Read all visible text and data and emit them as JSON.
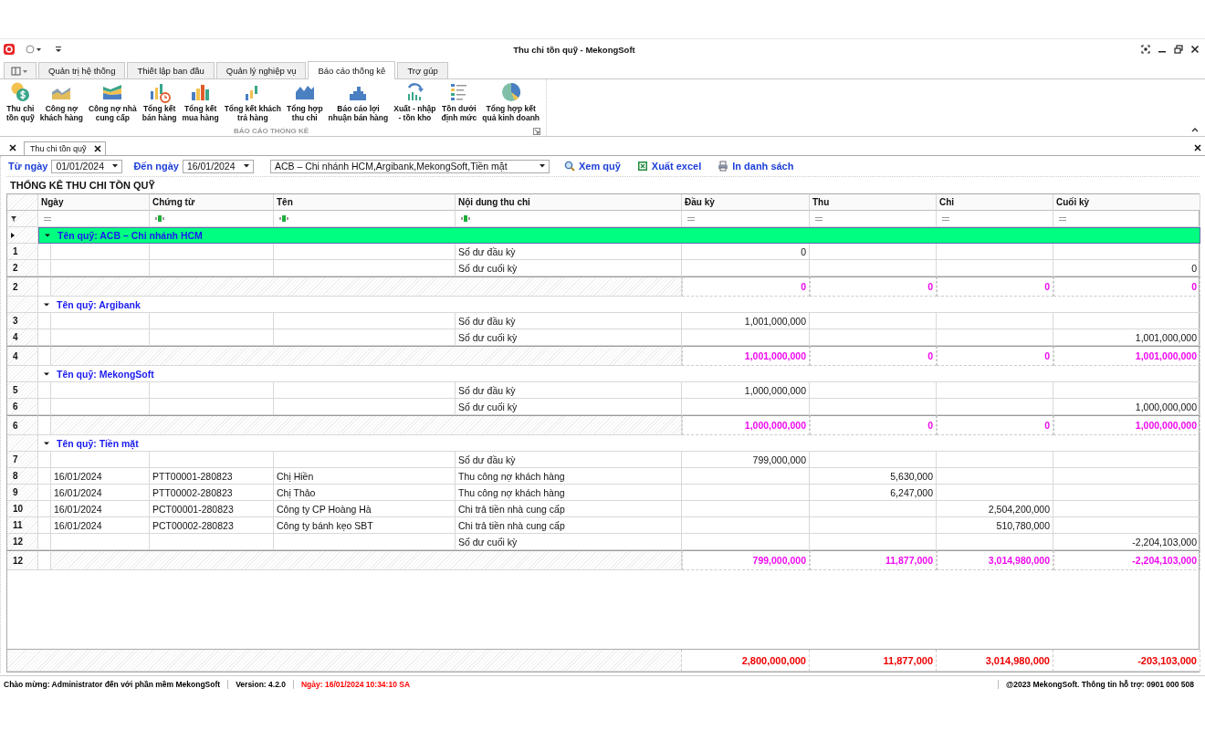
{
  "window": {
    "title": "Thu chi tồn quỹ - MekongSoft"
  },
  "tabs": [
    {
      "label": "Quản trị hệ thống",
      "selected": false
    },
    {
      "label": "Thiết lập ban đầu",
      "selected": false
    },
    {
      "label": "Quản lý nghiệp vụ",
      "selected": false
    },
    {
      "label": "Báo cáo thống kê",
      "selected": true
    },
    {
      "label": "Trợ gúp",
      "selected": false
    }
  ],
  "ribbon": {
    "group_label": "BÁO CÁO THỐNG KÊ",
    "buttons": [
      {
        "label": "Thu chi\ntồn quỹ"
      },
      {
        "label": "Công nợ\nkhách hàng"
      },
      {
        "label": "Công nợ nhà\ncung cấp"
      },
      {
        "label": "Tổng kết\nbán hàng"
      },
      {
        "label": "Tổng kết\nmua hàng"
      },
      {
        "label": "Tổng kết khách\ntrả hàng"
      },
      {
        "label": "Tổng hợp\nthu chi"
      },
      {
        "label": "Báo cáo lợi\nnhuận bán hàng"
      },
      {
        "label": "Xuất - nhập\n- tồn kho"
      },
      {
        "label": "Tồn dưới\nđịnh mức"
      },
      {
        "label": "Tổng hợp kết\nquả kinh doanh"
      }
    ]
  },
  "document_tabs": [
    {
      "label": "Thu chi tồn quỹ",
      "selected": true
    }
  ],
  "toolbar": {
    "from_label": "Từ ngày",
    "from_value": "01/01/2024",
    "to_label": "Đến ngày",
    "to_value": "16/01/2024",
    "fund_value": "ACB – Chi nhánh HCM,Argibank,MekongSoft,Tiền mặt",
    "buttons": [
      {
        "label": "Xem quỹ"
      },
      {
        "label": "Xuất excel"
      },
      {
        "label": "In danh sách"
      }
    ]
  },
  "report_title": "THỐNG KÊ THU CHI TỒN QUỸ",
  "grid": {
    "columns": [
      "Ngày",
      "Chứng từ",
      "Tên",
      "Nội dung thu chi",
      "Đầu kỳ",
      "Thu",
      "Chi",
      "Cuối kỳ"
    ],
    "groups": [
      {
        "title": "Tên quỹ: ACB – Chi nhánh HCM",
        "selected": true,
        "expanded": true,
        "rows": [
          {
            "number": "1",
            "content": "Số dư đầu kỳ",
            "opening": "0"
          },
          {
            "number": "2",
            "content": "Số dư cuối kỳ",
            "closing": "0"
          }
        ],
        "summary": {
          "number": "2",
          "opening": "0",
          "receipts": "0",
          "payments": "0",
          "closing": "0"
        }
      },
      {
        "title": "Tên quỹ: Argibank",
        "selected": false,
        "expanded": true,
        "rows": [
          {
            "number": "3",
            "content": "Số dư đầu kỳ",
            "opening": "1,001,000,000"
          },
          {
            "number": "4",
            "content": "Số dư cuối kỳ",
            "closing": "1,001,000,000"
          }
        ],
        "summary": {
          "number": "4",
          "opening": "1,001,000,000",
          "receipts": "0",
          "payments": "0",
          "closing": "1,001,000,000"
        }
      },
      {
        "title": "Tên quỹ: MekongSoft",
        "selected": false,
        "expanded": true,
        "rows": [
          {
            "number": "5",
            "content": "Số dư đầu kỳ",
            "opening": "1,000,000,000"
          },
          {
            "number": "6",
            "content": "Số dư cuối kỳ",
            "closing": "1,000,000,000"
          }
        ],
        "summary": {
          "number": "6",
          "opening": "1,000,000,000",
          "receipts": "0",
          "payments": "0",
          "closing": "1,000,000,000"
        }
      },
      {
        "title": "Tên quỹ: Tiền mặt",
        "selected": false,
        "expanded": true,
        "rows": [
          {
            "number": "7",
            "content": "Số dư đầu kỳ",
            "opening": "799,000,000"
          },
          {
            "number": "8",
            "date": "16/01/2024",
            "voucher": "PTT00001-280823",
            "name": "Chị Hiền",
            "content": "Thu công nợ khách hàng",
            "receipts": "5,630,000"
          },
          {
            "number": "9",
            "date": "16/01/2024",
            "voucher": "PTT00002-280823",
            "name": "Chị Thảo",
            "content": "Thu công nợ khách hàng",
            "receipts": "6,247,000"
          },
          {
            "number": "10",
            "date": "16/01/2024",
            "voucher": "PCT00001-280823",
            "name": "Công ty CP Hoàng Hà",
            "content": "Chi trả tiền nhà cung cấp",
            "payments": "2,504,200,000"
          },
          {
            "number": "11",
            "date": "16/01/2024",
            "voucher": "PCT00002-280823",
            "name": "Công ty bánh kẹo SBT",
            "content": "Chi trả tiền nhà cung cấp",
            "payments": "510,780,000"
          },
          {
            "number": "12",
            "content": "Số dư cuối kỳ",
            "closing": "-2,204,103,000"
          }
        ],
        "summary": {
          "number": "12",
          "opening": "799,000,000",
          "receipts": "11,877,000",
          "payments": "3,014,980,000",
          "closing": "-2,204,103,000"
        }
      }
    ],
    "totals": {
      "opening": "2,800,000,000",
      "receipts": "11,877,000",
      "payments": "3,014,980,000",
      "closing": "-203,103,000"
    }
  },
  "status_bar": [
    {
      "text": "Chào mừng: Administrator đến với phần mềm MekongSoft",
      "color": "#000000"
    },
    {
      "text": "Version: 4.2.0",
      "color": "#000000"
    },
    {
      "text": "Ngày: 16/01/2024 10:34:10 SA",
      "color": "#ff0000"
    },
    {
      "text": "@2023 MekongSoft. Thông tin hỗ trợ: 0901 000 508",
      "color": "#000000"
    }
  ]
}
